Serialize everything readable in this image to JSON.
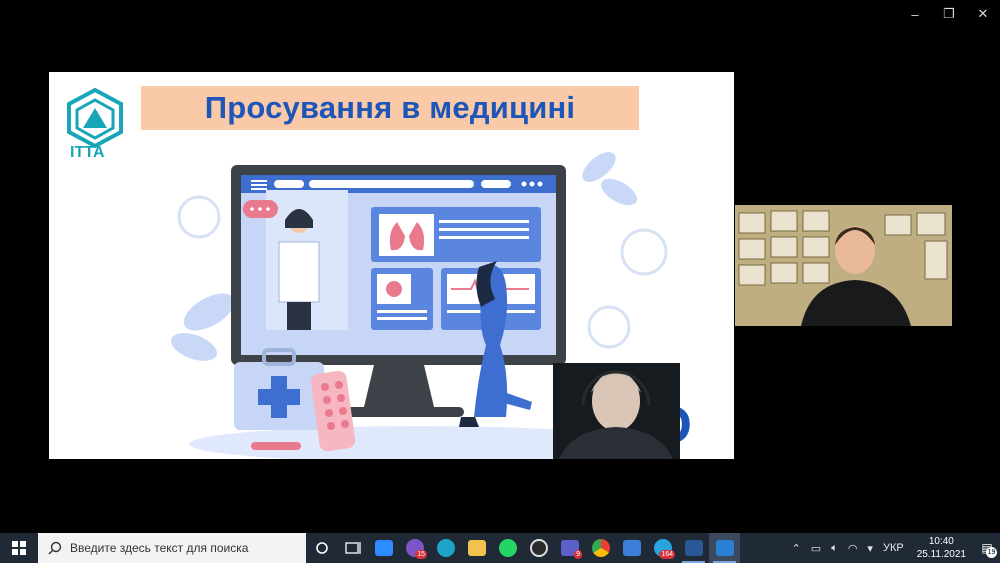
{
  "window_controls": {
    "minimize": "–",
    "restore": "❐",
    "close": "✕"
  },
  "slide": {
    "title": "Просування в медицині",
    "logo_text": "ІТТА",
    "brand_mark": "iD"
  },
  "taskbar": {
    "search_placeholder": "Введите здесь текст для поиска",
    "apps": [
      {
        "name": "task-view",
        "color": "#ffffff"
      },
      {
        "name": "rss-widget",
        "color": "#ffffff"
      },
      {
        "name": "zoom",
        "color": "#2d8cff"
      },
      {
        "name": "viber",
        "color": "#7c56c6",
        "badge": "15"
      },
      {
        "name": "edge",
        "color": "#1fa3c8"
      },
      {
        "name": "file-explorer",
        "color": "#f2c24e"
      },
      {
        "name": "whatsapp",
        "color": "#25d366"
      },
      {
        "name": "obs",
        "color": "#dddddd"
      },
      {
        "name": "teams",
        "color": "#5b5fc7",
        "badge": "9"
      },
      {
        "name": "chrome",
        "color": "#e94235"
      },
      {
        "name": "virtual-machine",
        "color": "#3b7fd8"
      },
      {
        "name": "telegram",
        "color": "#2aa3df",
        "badge": "164"
      },
      {
        "name": "word",
        "color": "#2b5797"
      },
      {
        "name": "media-player",
        "color": "#2a80d6"
      }
    ],
    "language": "УКР",
    "time": "10:40",
    "date": "25.11.2021",
    "notification_count": "19"
  }
}
